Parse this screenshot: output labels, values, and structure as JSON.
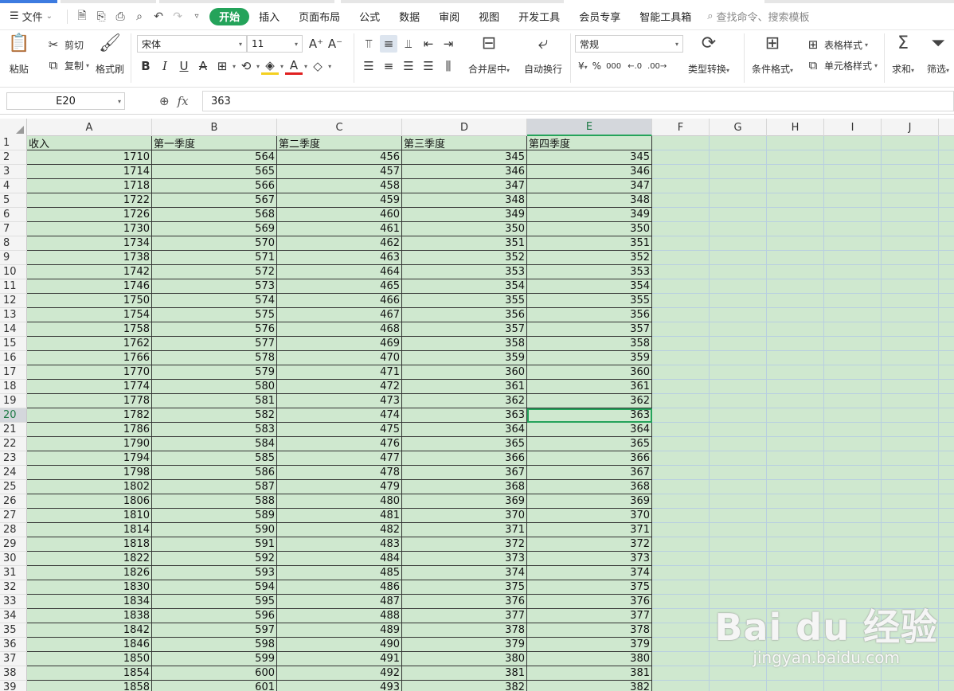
{
  "menu": {
    "file_label": "文件",
    "tabs": [
      {
        "label": "开始",
        "active": true
      },
      {
        "label": "插入"
      },
      {
        "label": "页面布局"
      },
      {
        "label": "公式"
      },
      {
        "label": "数据"
      },
      {
        "label": "审阅"
      },
      {
        "label": "视图"
      },
      {
        "label": "开发工具"
      },
      {
        "label": "会员专享"
      },
      {
        "label": "智能工具箱"
      }
    ],
    "search_label": "查找命令、搜索模板"
  },
  "ribbon": {
    "paste": "粘贴",
    "cut": "剪切",
    "copy": "复制",
    "format_painter": "格式刷",
    "font_name": "宋体",
    "font_size": "11",
    "merge_center": "合并居中",
    "auto_wrap": "自动换行",
    "number_format": "常规",
    "currency": "¥",
    "percent": "%",
    "thousands": "000",
    "type_convert": "类型转换",
    "conditional_format": "条件格式",
    "table_style": "表格样式",
    "cell_style": "单元格样式",
    "sum": "求和",
    "filter": "筛选"
  },
  "formula_bar": {
    "cell_ref": "E20",
    "value": "363"
  },
  "grid": {
    "columns": [
      "A",
      "B",
      "C",
      "D",
      "E",
      "F",
      "G",
      "H",
      "I",
      "J"
    ],
    "active_column": "E",
    "active_row": 20,
    "header_row": [
      "收入",
      "第一季度",
      "第二季度",
      "第三季度",
      "第四季度"
    ],
    "rows": [
      [
        1710,
        564,
        456,
        345,
        345
      ],
      [
        1714,
        565,
        457,
        346,
        346
      ],
      [
        1718,
        566,
        458,
        347,
        347
      ],
      [
        1722,
        567,
        459,
        348,
        348
      ],
      [
        1726,
        568,
        460,
        349,
        349
      ],
      [
        1730,
        569,
        461,
        350,
        350
      ],
      [
        1734,
        570,
        462,
        351,
        351
      ],
      [
        1738,
        571,
        463,
        352,
        352
      ],
      [
        1742,
        572,
        464,
        353,
        353
      ],
      [
        1746,
        573,
        465,
        354,
        354
      ],
      [
        1750,
        574,
        466,
        355,
        355
      ],
      [
        1754,
        575,
        467,
        356,
        356
      ],
      [
        1758,
        576,
        468,
        357,
        357
      ],
      [
        1762,
        577,
        469,
        358,
        358
      ],
      [
        1766,
        578,
        470,
        359,
        359
      ],
      [
        1770,
        579,
        471,
        360,
        360
      ],
      [
        1774,
        580,
        472,
        361,
        361
      ],
      [
        1778,
        581,
        473,
        362,
        362
      ],
      [
        1782,
        582,
        474,
        363,
        363
      ],
      [
        1786,
        583,
        475,
        364,
        364
      ],
      [
        1790,
        584,
        476,
        365,
        365
      ],
      [
        1794,
        585,
        477,
        366,
        366
      ],
      [
        1798,
        586,
        478,
        367,
        367
      ],
      [
        1802,
        587,
        479,
        368,
        368
      ],
      [
        1806,
        588,
        480,
        369,
        369
      ],
      [
        1810,
        589,
        481,
        370,
        370
      ],
      [
        1814,
        590,
        482,
        371,
        371
      ],
      [
        1818,
        591,
        483,
        372,
        372
      ],
      [
        1822,
        592,
        484,
        373,
        373
      ],
      [
        1826,
        593,
        485,
        374,
        374
      ],
      [
        1830,
        594,
        486,
        375,
        375
      ],
      [
        1834,
        595,
        487,
        376,
        376
      ],
      [
        1838,
        596,
        488,
        377,
        377
      ],
      [
        1842,
        597,
        489,
        378,
        378
      ],
      [
        1846,
        598,
        490,
        379,
        379
      ],
      [
        1850,
        599,
        491,
        380,
        380
      ],
      [
        1854,
        600,
        492,
        381,
        381
      ],
      [
        1858,
        601,
        493,
        382,
        382
      ]
    ]
  },
  "watermark": {
    "logo": "Bai du 经验",
    "url": "jingyan.baidu.com"
  },
  "colors": {
    "accent": "#24a35a",
    "cell_bg": "#cfe8cf"
  }
}
